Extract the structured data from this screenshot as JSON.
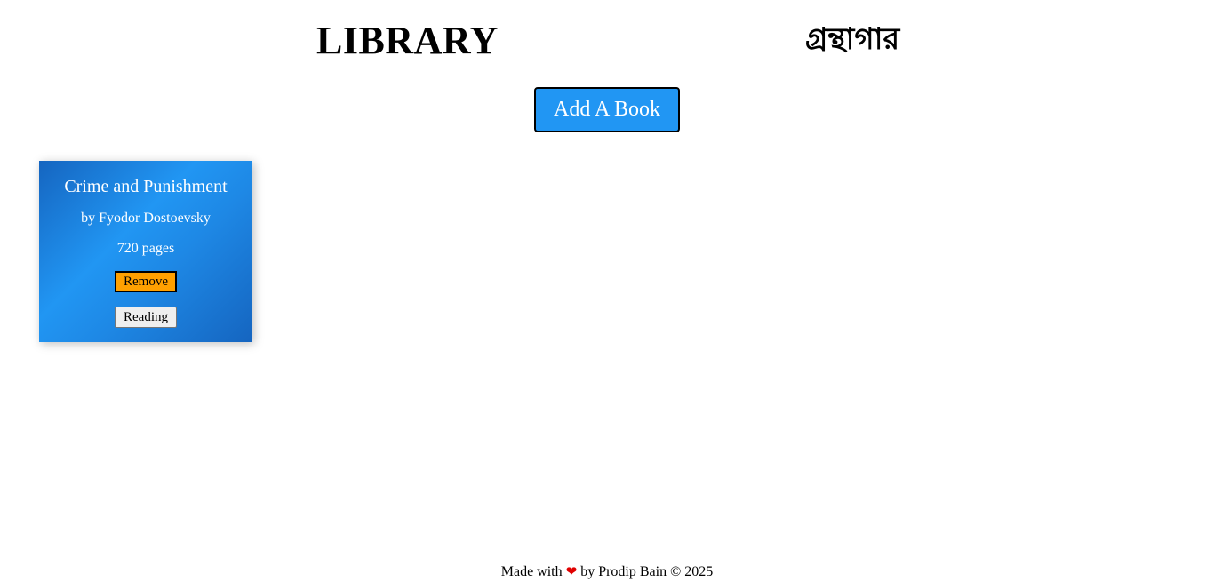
{
  "header": {
    "title_en": "LIBRARY",
    "title_bn": "গ্রন্থাগার"
  },
  "toolbar": {
    "add_label": "Add A Book"
  },
  "books": [
    {
      "title": "Crime and Punishment",
      "author": "by Fyodor Dostoevsky",
      "pages": "720 pages",
      "remove_label": "Remove",
      "status_label": "Reading"
    }
  ],
  "footer": {
    "made_with": "Made with",
    "heart": "❤",
    "by_text": "by Prodip Bain © 2025"
  },
  "colors": {
    "accent": "#2196F3",
    "remove": "#FFA000",
    "heart": "#e00000"
  }
}
